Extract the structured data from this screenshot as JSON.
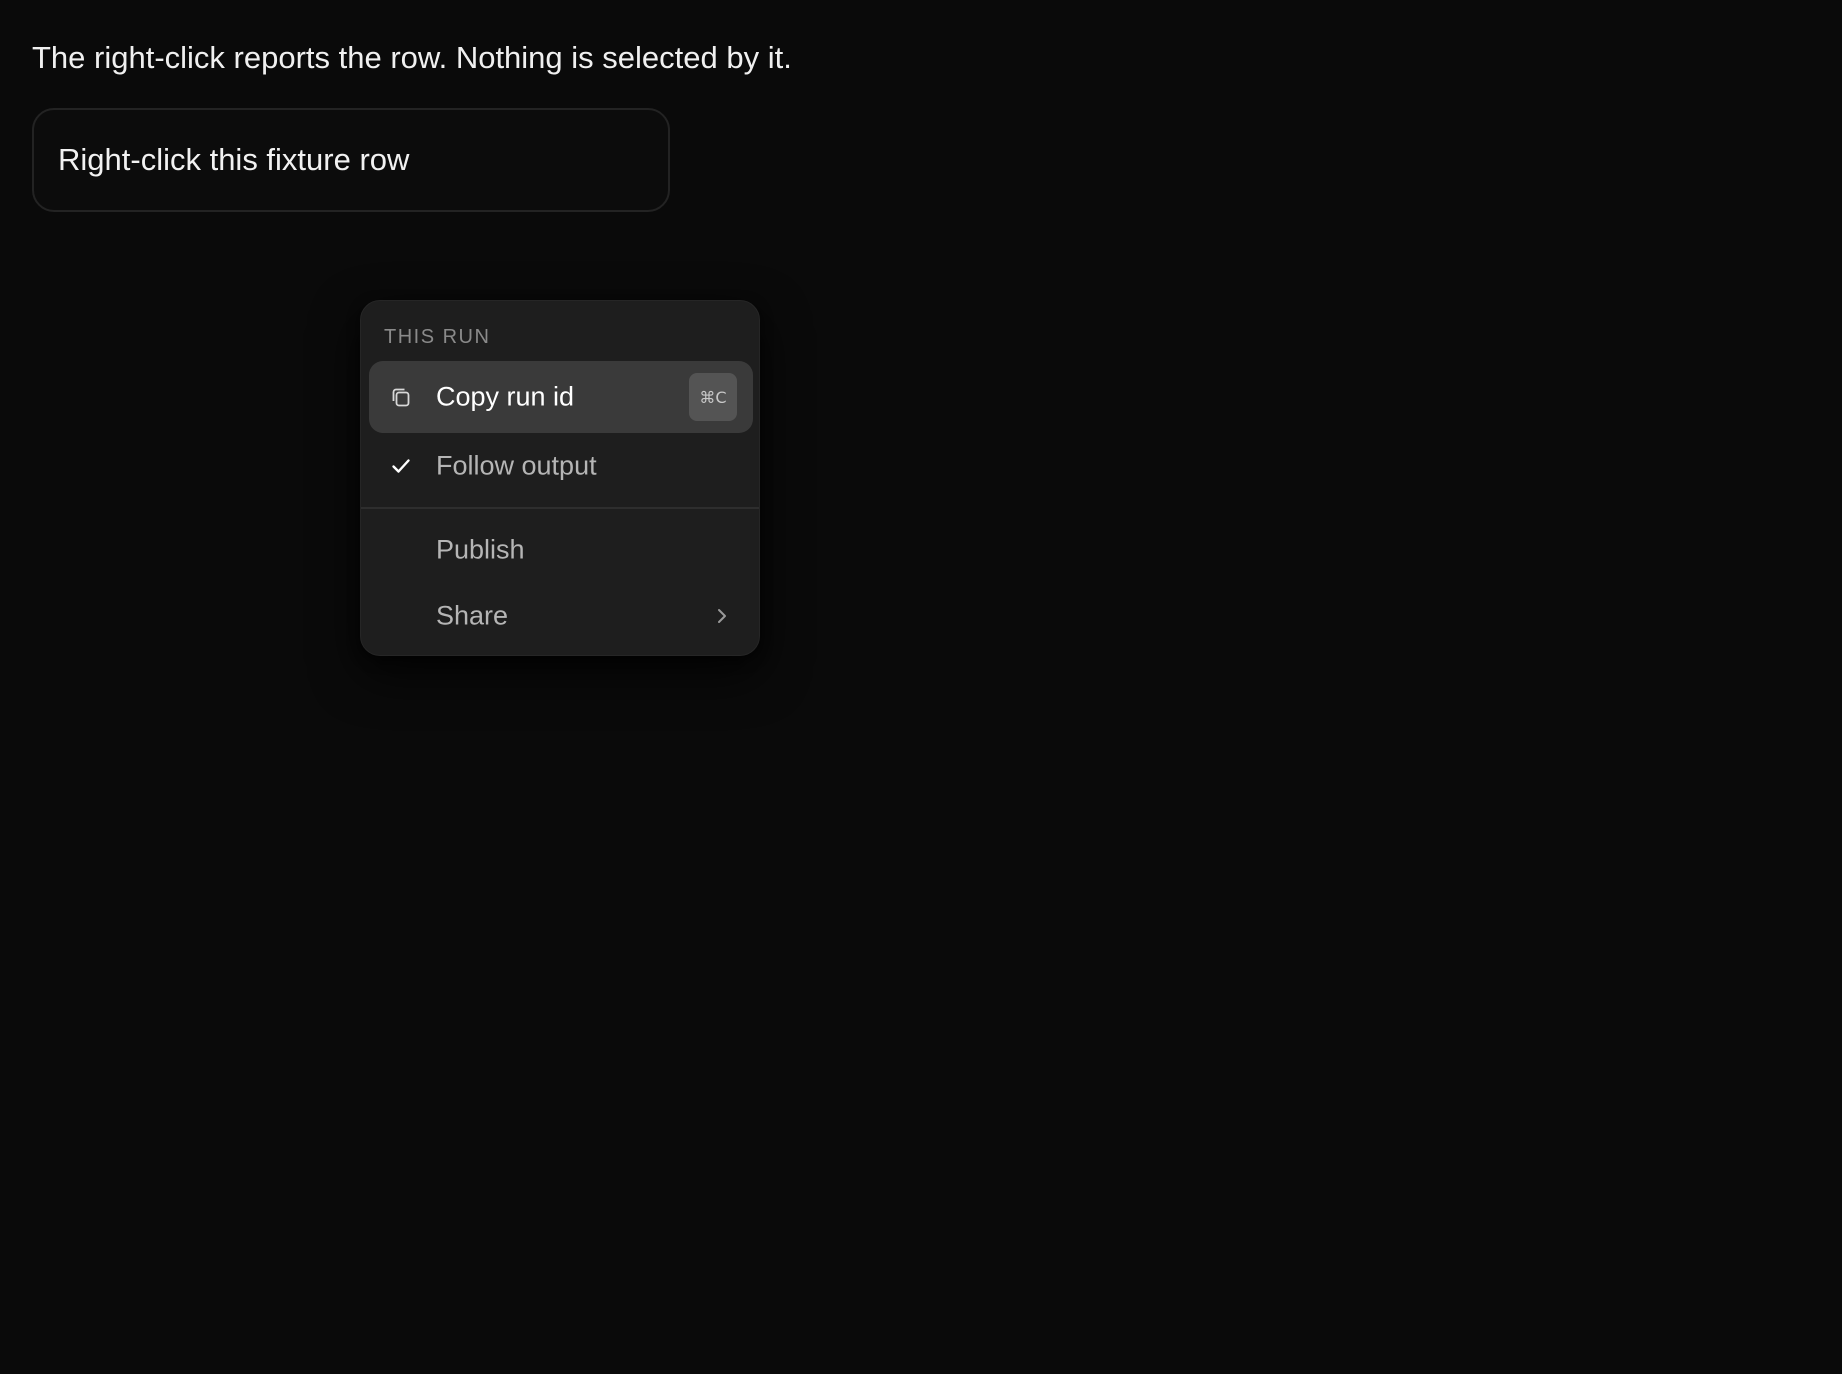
{
  "status": {
    "text": "The right-click reports the row. Nothing is selected by it."
  },
  "fixture_row": {
    "label": "Right-click this fixture row"
  },
  "context_menu": {
    "heading": "THIS RUN",
    "items": [
      {
        "label": "Copy run id",
        "icon": "copy-icon",
        "shortcut": "⌘C",
        "highlighted": true
      },
      {
        "label": "Follow output",
        "icon": "checkmark-icon",
        "checked": true
      },
      {
        "label": "Publish"
      },
      {
        "label": "Share",
        "icon": "chevron-right-icon",
        "has_submenu": true
      }
    ]
  },
  "colors": {
    "background": "#0a0a0a",
    "menu_background": "#1e1e1e",
    "highlight": "#3a3a3a"
  }
}
